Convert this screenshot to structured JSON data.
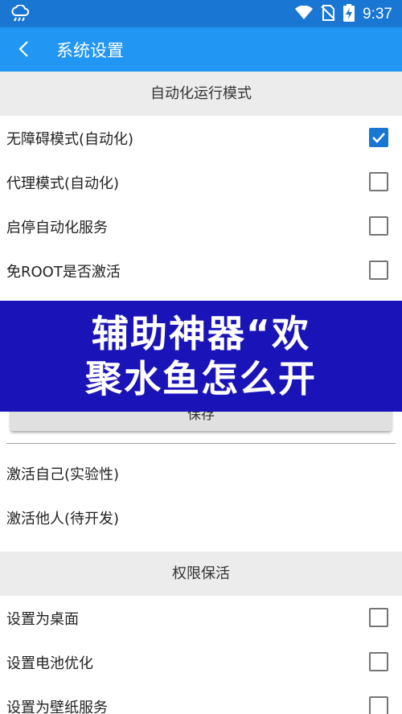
{
  "status_bar": {
    "time": "9:37",
    "icons": [
      "weather-rain-icon",
      "wifi-icon",
      "no-sim-icon",
      "battery-charging-icon"
    ]
  },
  "app_bar": {
    "back_icon": "back-arrow-icon",
    "title": "系统设置"
  },
  "sections": {
    "automation": {
      "header": "自动化运行模式",
      "items": [
        {
          "label": "无障碍模式(自动化)",
          "checked": true
        },
        {
          "label": "代理模式(自动化)",
          "checked": false
        },
        {
          "label": "启停自动化服务",
          "checked": false
        },
        {
          "label": "免ROOT是否激活",
          "checked": false
        }
      ]
    },
    "save_button_label": "保存",
    "activation": {
      "items": [
        {
          "label": "激活自己(实验性)"
        },
        {
          "label": "激活他人(待开发)"
        }
      ]
    },
    "keepalive": {
      "header": "权限保活",
      "items": [
        {
          "label": "设置为桌面",
          "checked": false
        },
        {
          "label": "设置电池优化",
          "checked": false
        },
        {
          "label": "设置为壁纸服务",
          "checked": false
        }
      ]
    }
  },
  "banner": {
    "line1": "辅助神器“欢",
    "line2": "聚水鱼怎么开"
  },
  "colors": {
    "status_bar": "#1976d2",
    "app_bar": "#2196f3",
    "checkbox_checked": "#1976d2",
    "banner": "#1a14b8"
  }
}
